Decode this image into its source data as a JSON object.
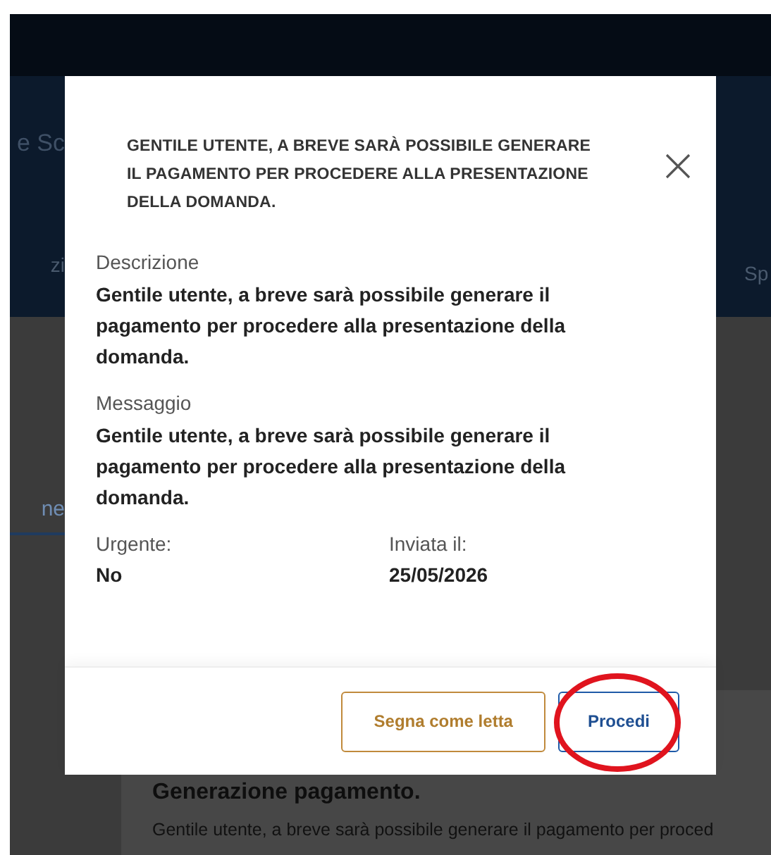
{
  "background": {
    "header_title": "e Sc",
    "nav_items": [
      {
        "label": "zi"
      },
      {
        "label": "Sp"
      }
    ],
    "tab": {
      "label": "ne",
      "selected": true
    },
    "card": {
      "title": "Generazione pagamento.",
      "text": "Gentile utente, a breve sarà possibile generare il pagamento per proced"
    }
  },
  "dialog": {
    "title": "GENTILE UTENTE, A BREVE SARÀ POSSIBILE GENERARE IL PAGAMENTO PER PROCEDERE ALLA PRESENTAZIONE DELLA DOMANDA.",
    "fields": [
      {
        "label": "Descrizione",
        "value": "Gentile utente, a breve sarà possibile generare il pagamento per procedere alla presentazione della domanda."
      },
      {
        "label": "Messaggio",
        "value": "Gentile utente, a breve sarà possibile generare il pagamento per procedere alla presentazione della domanda."
      }
    ],
    "meta": [
      {
        "label": "Urgente:",
        "value": "No"
      },
      {
        "label": "Inviata il:",
        "value": "25/05/2026"
      }
    ],
    "buttons": [
      {
        "label": "Segna come letta",
        "kind": "secondary",
        "circled": false
      },
      {
        "label": "Procedi",
        "kind": "primary",
        "circled": true
      }
    ]
  }
}
